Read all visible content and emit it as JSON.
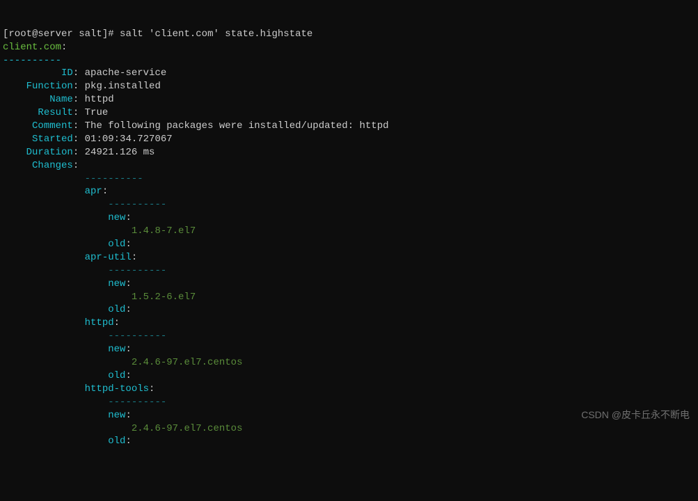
{
  "prompt": {
    "user_host": "[root@server salt]#",
    "command": "salt 'client.com' state.highstate"
  },
  "target": "client.com",
  "target_sep": "----------",
  "labels": {
    "id": "ID",
    "function": "Function",
    "name": "Name",
    "result": "Result",
    "comment": "Comment",
    "started": "Started",
    "duration": "Duration",
    "changes": "Changes"
  },
  "values": {
    "id": "apache-service",
    "function": "pkg.installed",
    "name": "httpd",
    "result": "True",
    "comment": "The following packages were installed/updated: httpd",
    "started": "01:09:34.727067",
    "duration": "24921.126 ms"
  },
  "changes_sep": "----------",
  "pkg_sep": "----------",
  "new_label": "new",
  "old_label": "old",
  "packages": {
    "apr": {
      "new": "1.4.8-7.el7",
      "old": ""
    },
    "apr_util": {
      "name": "apr-util",
      "new": "1.5.2-6.el7",
      "old": ""
    },
    "httpd": {
      "new": "2.4.6-97.el7.centos",
      "old": ""
    },
    "httpd_tools": {
      "name": "httpd-tools",
      "new": "2.4.6-97.el7.centos",
      "old": ""
    }
  },
  "watermark": "CSDN @皮卡丘永不断电"
}
